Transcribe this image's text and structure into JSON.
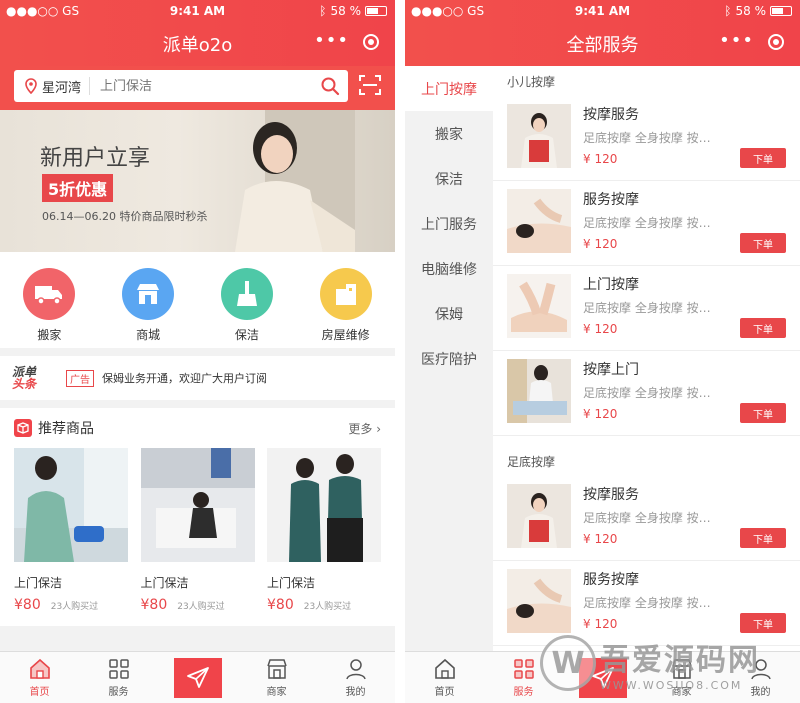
{
  "status": {
    "carrier": "●●●○○ GS",
    "time": "9:41 AM",
    "battery": "58 %"
  },
  "panel1": {
    "title": "派单o2o",
    "location": "星河湾",
    "search_placeholder": "上门保洁",
    "banner": {
      "headline": "新用户立享",
      "badge": "5折优惠",
      "date_text": "06.14—06.20  特价商品限时秒杀"
    },
    "categories": [
      {
        "label": "搬家",
        "color": "#f16469"
      },
      {
        "label": "商城",
        "color": "#5aa6f2"
      },
      {
        "label": "保洁",
        "color": "#4ec8a7"
      },
      {
        "label": "房屋维修",
        "color": "#f6c94d"
      }
    ],
    "news": {
      "logo_line1": "派单",
      "logo_line2": "头条",
      "tag": "广告",
      "text": "保姆业务开通，欢迎广大用户订阅"
    },
    "recommend": {
      "title": "推荐商品",
      "more": "更多",
      "goods": [
        {
          "name": "上门保洁",
          "price": "¥80",
          "sold": "23人购买过"
        },
        {
          "name": "上门保洁",
          "price": "¥80",
          "sold": "23人购买过"
        },
        {
          "name": "上门保洁",
          "price": "¥80",
          "sold": "23人购买过"
        }
      ]
    },
    "tabs": [
      {
        "label": "首页"
      },
      {
        "label": "服务"
      },
      {
        "label": ""
      },
      {
        "label": "商家"
      },
      {
        "label": "我的"
      }
    ]
  },
  "panel2": {
    "title": "全部服务",
    "sidebar": [
      "上门按摩",
      "搬家",
      "保洁",
      "上门服务",
      "电脑维修",
      "保姆",
      "医疗陪护"
    ],
    "sections": [
      {
        "heading": "小儿按摩",
        "items": [
          {
            "title": "按摩服务",
            "tags": "足底按摩    全身按摩    按…",
            "price": "¥ 120",
            "button": "下单"
          },
          {
            "title": "服务按摩",
            "tags": "足底按摩    全身按摩    按…",
            "price": "¥ 120",
            "button": "下单"
          },
          {
            "title": "上门按摩",
            "tags": "足底按摩    全身按摩    按…",
            "price": "¥ 120",
            "button": "下单"
          },
          {
            "title": "按摩上门",
            "tags": "足底按摩    全身按摩    按…",
            "price": "¥ 120",
            "button": "下单"
          }
        ]
      },
      {
        "heading": "足底按摩",
        "items": [
          {
            "title": "按摩服务",
            "tags": "足底按摩    全身按摩    按…",
            "price": "¥ 120",
            "button": "下单"
          },
          {
            "title": "服务按摩",
            "tags": "足底按摩    全身按摩    按…",
            "price": "¥ 120",
            "button": "下单"
          }
        ]
      }
    ],
    "tabs": [
      {
        "label": "首页"
      },
      {
        "label": "服务"
      },
      {
        "label": ""
      },
      {
        "label": "商家"
      },
      {
        "label": "我的"
      }
    ]
  },
  "watermark": {
    "mark": "W",
    "text": "吾爱源码网",
    "url": "WWW.WOSUO8.COM"
  },
  "colors": {
    "accent": "#e8474a",
    "header": "#f2504c"
  }
}
